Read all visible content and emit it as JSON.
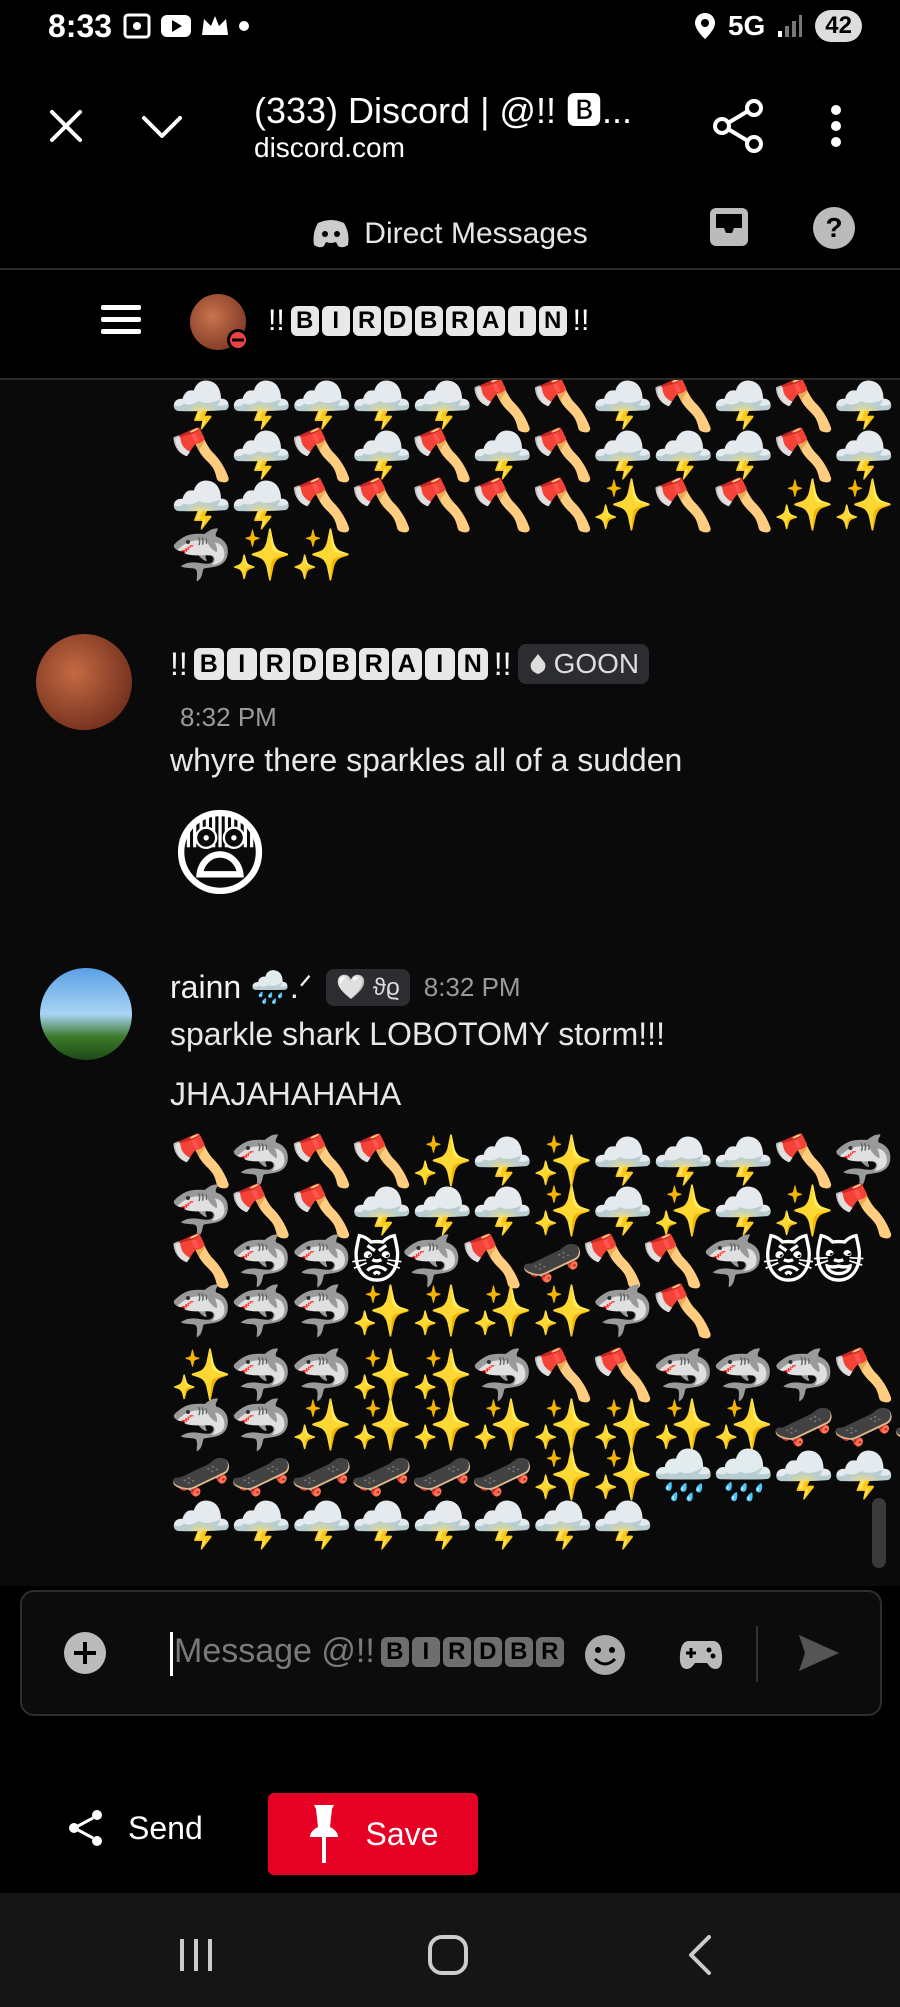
{
  "status_bar": {
    "time": "8:33",
    "network": "5G",
    "battery": "42"
  },
  "browser": {
    "title": "(333) Discord | @!! 🅱...",
    "url": "discord.com"
  },
  "dm_header": {
    "label": "Direct Messages"
  },
  "user_bar": {
    "prefix": "!!",
    "letters": [
      "B",
      "I",
      "R",
      "D",
      "B",
      "R",
      "A",
      "I",
      "N"
    ],
    "suffix": "!!"
  },
  "chat": {
    "top_emoji_rows": [
      "🌩️🌩️🌩️🌩️🌩️🪓🪓🌩️🪓🌩️🪓🌩️",
      "🪓🌩️🪓🌩️🪓🌩️🪓🌩️🌩️🌩️🪓🌩️",
      "🌩️🌩️🪓🪓🪓🪓🪓✨🪓🪓✨✨",
      "🦈✨✨"
    ],
    "messages": [
      {
        "author_prefix": "!!",
        "author_letters": [
          "B",
          "I",
          "R",
          "D",
          "B",
          "R",
          "A",
          "I",
          "N"
        ],
        "author_suffix": "!!",
        "role": "GOON",
        "time": "8:32 PM",
        "text": "whyre there sparkles all of a sudden",
        "emoji": "😨"
      },
      {
        "author": "rainn 🌧️.ᐟ",
        "tag": "🤍 ϑϱ",
        "time": "8:32 PM",
        "lines": [
          "sparkle shark LOBOTOMY storm!!!",
          "JHAJAHAHAHA"
        ],
        "emoji_rows": [
          "🪓🦈🪓🪓✨🌩️✨🌩️🌩️🌩️🪓🦈",
          "🦈🪓🪓🌩️🌩️🌩️✨🌩️✨🌩️✨🪓",
          "🪓🦈🦈😾🦈🪓🛹🪓🪓🦈😾😺",
          "🦈🦈🦈✨✨✨✨🦈🪓",
          "✨🦈🦈✨✨🦈🪓🪓🦈🦈🦈🪓",
          "🦈🦈✨✨✨✨✨✨✨✨🛹🛹🛹",
          "🛹🛹🛹🛹🛹🛹✨✨🌧️🌧️🌩️🌩️",
          "🌩️🌩️🌩️🌩️🌩️🌩️🌩️🌩️"
        ]
      }
    ]
  },
  "input": {
    "placeholder_prefix": "Message @!!",
    "placeholder_letters": [
      "B",
      "I",
      "R",
      "D",
      "B",
      "R"
    ]
  },
  "bottom": {
    "send_label": "Send",
    "save_label": "Save"
  },
  "colors": {
    "save": "#e60023",
    "background": "#000000"
  }
}
